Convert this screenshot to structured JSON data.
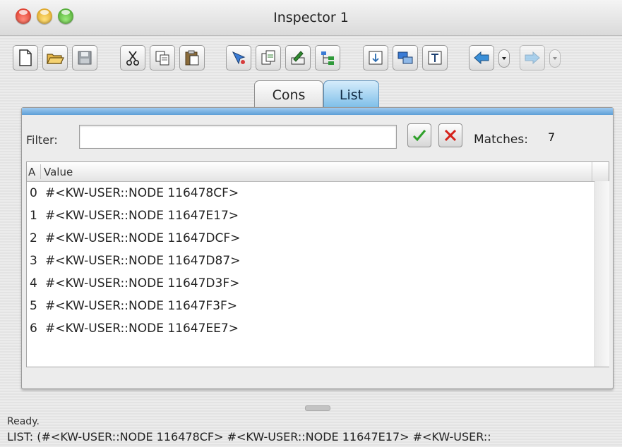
{
  "window": {
    "title": "Inspector 1",
    "traffic_lights": [
      "close",
      "minimize",
      "zoom"
    ]
  },
  "toolbar": {
    "buttons": [
      "new-document-icon",
      "open-folder-icon",
      "save-disk-icon",
      "cut-scissors-icon",
      "copy-icon",
      "paste-icon",
      "inspect-pick-icon",
      "duplicate-icon",
      "edit-icon",
      "tree-view-icon",
      "refresh-icon",
      "window-layout-icon",
      "text-view-icon",
      "back-arrow-icon",
      "back-history-dropdown",
      "forward-arrow-icon",
      "forward-history-dropdown"
    ]
  },
  "tabs": [
    {
      "label": "Cons",
      "selected": false
    },
    {
      "label": "List",
      "selected": true
    }
  ],
  "filter": {
    "label": "Filter:",
    "value": "",
    "matches_label": "Matches:",
    "matches_value": "7"
  },
  "table": {
    "headers": {
      "index": "A",
      "value": "Value"
    },
    "rows": [
      {
        "index": "0",
        "value": "#<KW-USER::NODE 116478CF>"
      },
      {
        "index": "1",
        "value": "#<KW-USER::NODE 11647E17>"
      },
      {
        "index": "2",
        "value": "#<KW-USER::NODE 11647DCF>"
      },
      {
        "index": "3",
        "value": "#<KW-USER::NODE 11647D87>"
      },
      {
        "index": "4",
        "value": "#<KW-USER::NODE 11647D3F>"
      },
      {
        "index": "5",
        "value": "#<KW-USER::NODE 11647F3F>"
      },
      {
        "index": "6",
        "value": "#<KW-USER::NODE 11647EE7>"
      }
    ]
  },
  "status": {
    "message": "Ready.",
    "list_line": "LIST: (#<KW-USER::NODE 116478CF> #<KW-USER::NODE 11647E17> #<KW-USER::"
  },
  "colors": {
    "tab_selected": "#7bbde8",
    "panel_accent": "#5d9fd6",
    "accept_green": "#2fa02a",
    "reject_red": "#d5221b"
  }
}
